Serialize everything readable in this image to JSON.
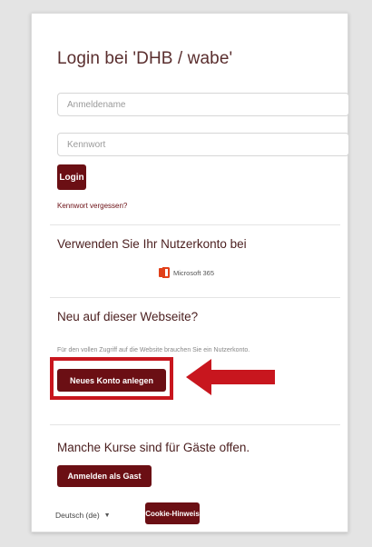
{
  "login": {
    "title": "Login bei 'DHB / wabe'",
    "username_placeholder": "Anmeldename",
    "password_placeholder": "Kennwort",
    "login_button": "Login",
    "forgot_link": "Kennwort vergessen?"
  },
  "external": {
    "title": "Verwenden Sie Ihr Nutzerkonto bei",
    "provider_label": "Microsoft 365",
    "provider_icon": "office-icon"
  },
  "signup": {
    "title": "Neu auf dieser Webseite?",
    "text": "Für den vollen Zugriff auf die Website brauchen Sie ein Nutzerkonto.",
    "create_button": "Neues Konto anlegen"
  },
  "guest": {
    "title": "Manche Kurse sind für Gäste offen.",
    "guest_button": "Anmelden als Gast"
  },
  "footer": {
    "language": "Deutsch (de)",
    "cookie_button": "Cookie-Hinweis"
  },
  "colors": {
    "primary": "#6b0f14",
    "highlight": "#c8161e"
  }
}
